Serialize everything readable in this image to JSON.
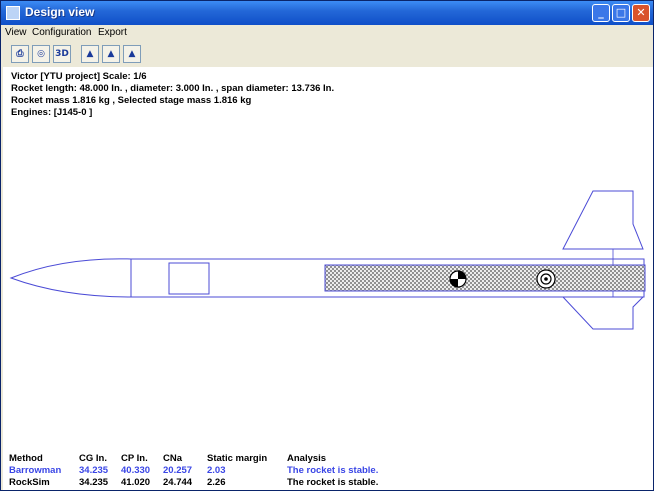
{
  "window": {
    "title": "Design view",
    "minimize_glyph": "_",
    "maximize_glyph": "□",
    "close_glyph": "✕"
  },
  "menu": {
    "items": [
      "View",
      "Configuration",
      "Export"
    ]
  },
  "toolbar": {
    "buttons": [
      {
        "icon": "print-icon",
        "glyph": "⎙"
      },
      {
        "icon": "view-2d-icon",
        "glyph": "◎"
      },
      {
        "icon": "view-3d-icon",
        "glyph": "3D"
      },
      {
        "icon": "stage-1-icon",
        "glyph": "▲"
      },
      {
        "icon": "stage-2-icon",
        "glyph": "▲"
      },
      {
        "icon": "stage-3-icon",
        "glyph": "▲"
      }
    ]
  },
  "info": {
    "line1": "Victor [YTU project]   Scale: 1/6",
    "line2": "Rocket length: 48.000  In. , diameter: 3.000  In. , span diameter: 13.736  In.",
    "line3": "Rocket mass 1.816 kg , Selected stage mass 1.816 kg",
    "line4": "Engines: [J145-0   ]"
  },
  "stability": {
    "headers": [
      "Method",
      "CG In.",
      "CP In.",
      "CNa",
      "Static margin",
      "Analysis"
    ],
    "rows": [
      {
        "method": "Barrowman",
        "cg": "34.235",
        "cp": "40.330",
        "cna": "20.257",
        "margin": "2.03",
        "analysis": "The rocket is stable."
      },
      {
        "method": "RockSim",
        "cg": "34.235",
        "cp": "41.020",
        "cna": "24.744",
        "margin": "2.26",
        "analysis": "The rocket is stable."
      }
    ]
  },
  "colors": {
    "outline": "#4b4bd6",
    "cp_marker": "#000000"
  }
}
